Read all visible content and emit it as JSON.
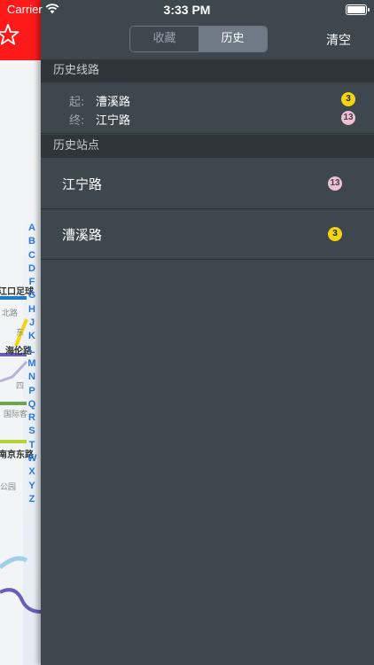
{
  "status_bar": {
    "carrier": "Carrier",
    "time": "3:33 PM"
  },
  "segmented": {
    "tabs": [
      {
        "label": "收藏",
        "selected": false
      },
      {
        "label": "历史",
        "selected": true
      }
    ]
  },
  "header": {
    "clear_label": "清空"
  },
  "history_routes": {
    "title": "历史线路",
    "items": [
      {
        "start_label": "起:",
        "start_name": "漕溪路",
        "start_line": "3",
        "end_label": "终:",
        "end_name": "江宁路",
        "end_line": "13"
      }
    ]
  },
  "history_stations": {
    "title": "历史站点",
    "items": [
      {
        "name": "江宁路",
        "line": "13"
      },
      {
        "name": "漕溪路",
        "line": "3"
      }
    ]
  },
  "background_map": {
    "index_letters": [
      "A",
      "B",
      "C",
      "D",
      "F",
      "G",
      "H",
      "J",
      "K",
      "L",
      "M",
      "N",
      "P",
      "Q",
      "R",
      "S",
      "T",
      "W",
      "X",
      "Y",
      "Z"
    ],
    "labels": [
      "江口足球",
      "北路",
      "东",
      "海伦路",
      "四",
      "国际客",
      "南京东路",
      "公园"
    ]
  },
  "colors": {
    "line3": "#f5d40e",
    "line13": "#efbfd6",
    "map_header": "#ff1a1a",
    "panel": "#3e464e"
  }
}
